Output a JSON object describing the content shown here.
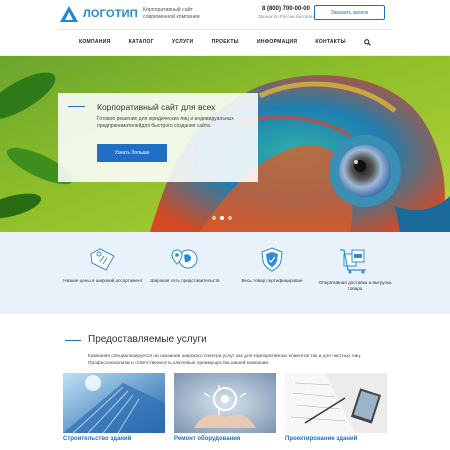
{
  "header": {
    "logo_text": "ЛОГОТИП",
    "tagline": "Корпоративный сайт современной компании",
    "phone": "8 (800) 700-00-00",
    "phone_note": "Звонок по России бесплатный",
    "call_button": "Заказать звонок"
  },
  "nav": {
    "items": [
      "КОМПАНИЯ",
      "КАТАЛОГ",
      "УСЛУГИ",
      "ПРОЕКТЫ",
      "ИНФОРМАЦИЯ",
      "КОНТАКТЫ"
    ],
    "search_icon": "search-icon"
  },
  "hero": {
    "title": "Корпоративный сайт для всех",
    "text": "Готовое решение для юридических лиц и индивидуальных предпринимателейдля быстрого создания сайта.",
    "button": "Узнать больше",
    "slides_total": 3,
    "slide_active": 2
  },
  "features": [
    {
      "label": "Низкие цены и широкий ассортимент",
      "icon": "price-tag-icon"
    },
    {
      "label": "Широкая сеть представительств",
      "icon": "map-pin-icon"
    },
    {
      "label": "Весь товар сертифицирован",
      "icon": "certified-shield-icon"
    },
    {
      "label": "Оперативная доставка и выгрузка товара",
      "icon": "delivery-cart-icon"
    }
  ],
  "services": {
    "title": "Предоставляемые услуги",
    "description": "Компания специализируется на оказании широкого спектра услуг как для корпоративных клиентов так и для частных лиц. Профессионализм и ответственность ключевые преимущества нашей компании.",
    "cards": [
      {
        "title": "Строительство зданий"
      },
      {
        "title": "Ремонт оборудования"
      },
      {
        "title": "Проектирование зданий"
      }
    ]
  },
  "colors": {
    "accent": "#1f6fc7",
    "logo": "#1f88d8",
    "features_bg": "#e9f1fa"
  }
}
